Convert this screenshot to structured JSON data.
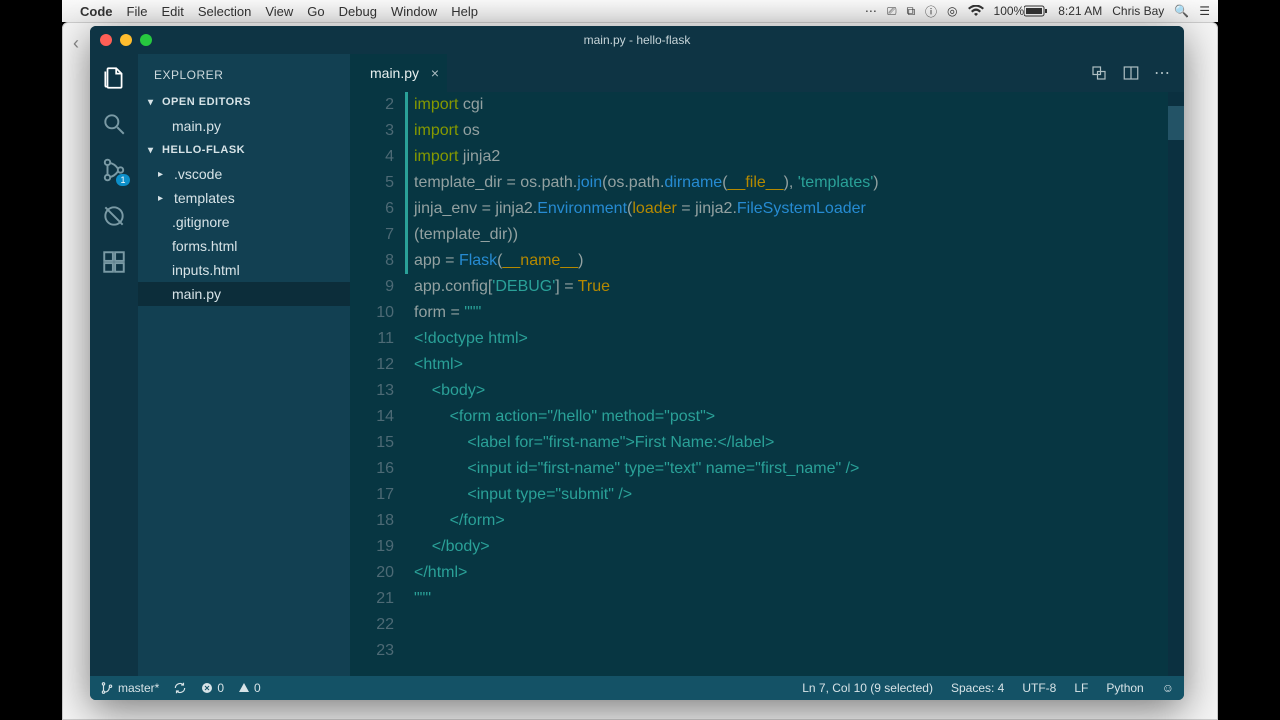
{
  "menubar": {
    "app": "Code",
    "items": [
      "File",
      "Edit",
      "Selection",
      "View",
      "Go",
      "Debug",
      "Window",
      "Help"
    ],
    "right": {
      "battery": "100%",
      "time": "8:21 AM",
      "user": "Chris Bay"
    }
  },
  "window": {
    "title": "main.py - hello-flask"
  },
  "activitybar": {
    "git_badge": "1"
  },
  "sidebar": {
    "title": "EXPLORER",
    "sections": {
      "open_editors": {
        "label": "OPEN EDITORS",
        "items": [
          "main.py"
        ]
      },
      "folder": {
        "label": "HELLO-FLASK",
        "items": [
          {
            "label": ".vscode",
            "folder": true
          },
          {
            "label": "templates",
            "folder": true
          },
          {
            "label": ".gitignore",
            "folder": false
          },
          {
            "label": "forms.html",
            "folder": false
          },
          {
            "label": "inputs.html",
            "folder": false
          },
          {
            "label": "main.py",
            "folder": false,
            "selected": true
          }
        ]
      }
    }
  },
  "tabs": {
    "active": "main.py"
  },
  "editor": {
    "first_line": 2,
    "lines": [
      {
        "n": 2,
        "tokens": [
          {
            "t": "import ",
            "c": "kw"
          },
          {
            "t": "cgi",
            "c": "id"
          }
        ]
      },
      {
        "n": 3,
        "tokens": [
          {
            "t": "import ",
            "c": "kw"
          },
          {
            "t": "os",
            "c": "id"
          }
        ]
      },
      {
        "n": 4,
        "tokens": [
          {
            "t": "import ",
            "c": "kw"
          },
          {
            "t": "jinja2",
            "c": "id"
          }
        ]
      },
      {
        "n": 5,
        "tokens": [
          {
            "t": "",
            "c": "id"
          }
        ]
      },
      {
        "n": 6,
        "tokens": [
          {
            "t": "template_dir = os.path.",
            "c": "id"
          },
          {
            "t": "join",
            "c": "fn"
          },
          {
            "t": "(os.path.",
            "c": "id"
          },
          {
            "t": "dirname",
            "c": "fn"
          },
          {
            "t": "(",
            "c": "id"
          },
          {
            "t": "__file__",
            "c": "const"
          },
          {
            "t": "), ",
            "c": "id"
          },
          {
            "t": "'templates'",
            "c": "str"
          },
          {
            "t": ")",
            "c": "id"
          }
        ]
      },
      {
        "n": 7,
        "tokens": [
          {
            "t": "jinja_env = jinja2.",
            "c": "id"
          },
          {
            "t": "Environment",
            "c": "fn"
          },
          {
            "t": "(",
            "c": "id"
          },
          {
            "t": "loader",
            "c": "const"
          },
          {
            "t": " = jinja2.",
            "c": "id"
          },
          {
            "t": "FileSystemLoader",
            "c": "fn"
          }
        ]
      },
      {
        "n": 0,
        "tokens": [
          {
            "t": "(template_dir))",
            "c": "id"
          }
        ]
      },
      {
        "n": 8,
        "tokens": [
          {
            "t": "",
            "c": "id"
          }
        ]
      },
      {
        "n": 9,
        "tokens": [
          {
            "t": "app = ",
            "c": "id"
          },
          {
            "t": "Flask",
            "c": "fn"
          },
          {
            "t": "(",
            "c": "id"
          },
          {
            "t": "__name__",
            "c": "const"
          },
          {
            "t": ")",
            "c": "id"
          }
        ]
      },
      {
        "n": 10,
        "tokens": [
          {
            "t": "app.config[",
            "c": "id"
          },
          {
            "t": "'DEBUG'",
            "c": "str"
          },
          {
            "t": "] = ",
            "c": "id"
          },
          {
            "t": "True",
            "c": "const"
          }
        ]
      },
      {
        "n": 11,
        "tokens": [
          {
            "t": "",
            "c": "id"
          }
        ]
      },
      {
        "n": 12,
        "tokens": [
          {
            "t": "form = ",
            "c": "id"
          },
          {
            "t": "\"\"\"",
            "c": "str"
          }
        ]
      },
      {
        "n": 13,
        "tokens": [
          {
            "t": "<!doctype html>",
            "c": "str"
          }
        ]
      },
      {
        "n": 14,
        "tokens": [
          {
            "t": "<html>",
            "c": "str"
          }
        ]
      },
      {
        "n": 15,
        "tokens": [
          {
            "t": "    <body>",
            "c": "str"
          }
        ]
      },
      {
        "n": 16,
        "tokens": [
          {
            "t": "        <form action=\"/hello\" method=\"post\">",
            "c": "str"
          }
        ]
      },
      {
        "n": 17,
        "tokens": [
          {
            "t": "            <label for=\"first-name\">First Name:</label>",
            "c": "str"
          }
        ]
      },
      {
        "n": 18,
        "tokens": [
          {
            "t": "            <input id=\"first-name\" type=\"text\" name=\"first_name\" />",
            "c": "str"
          }
        ]
      },
      {
        "n": 19,
        "tokens": [
          {
            "t": "            <input type=\"submit\" />",
            "c": "str"
          }
        ]
      },
      {
        "n": 20,
        "tokens": [
          {
            "t": "        </form>",
            "c": "str"
          }
        ]
      },
      {
        "n": 21,
        "tokens": [
          {
            "t": "    </body>",
            "c": "str"
          }
        ]
      },
      {
        "n": 22,
        "tokens": [
          {
            "t": "</html>",
            "c": "str"
          }
        ]
      },
      {
        "n": 23,
        "tokens": [
          {
            "t": "\"\"\"",
            "c": "str"
          }
        ]
      }
    ]
  },
  "statusbar": {
    "branch": "master*",
    "errors": "0",
    "warnings": "0",
    "cursor": "Ln 7, Col 10 (9 selected)",
    "spaces": "Spaces: 4",
    "encoding": "UTF-8",
    "eol": "LF",
    "language": "Python"
  }
}
